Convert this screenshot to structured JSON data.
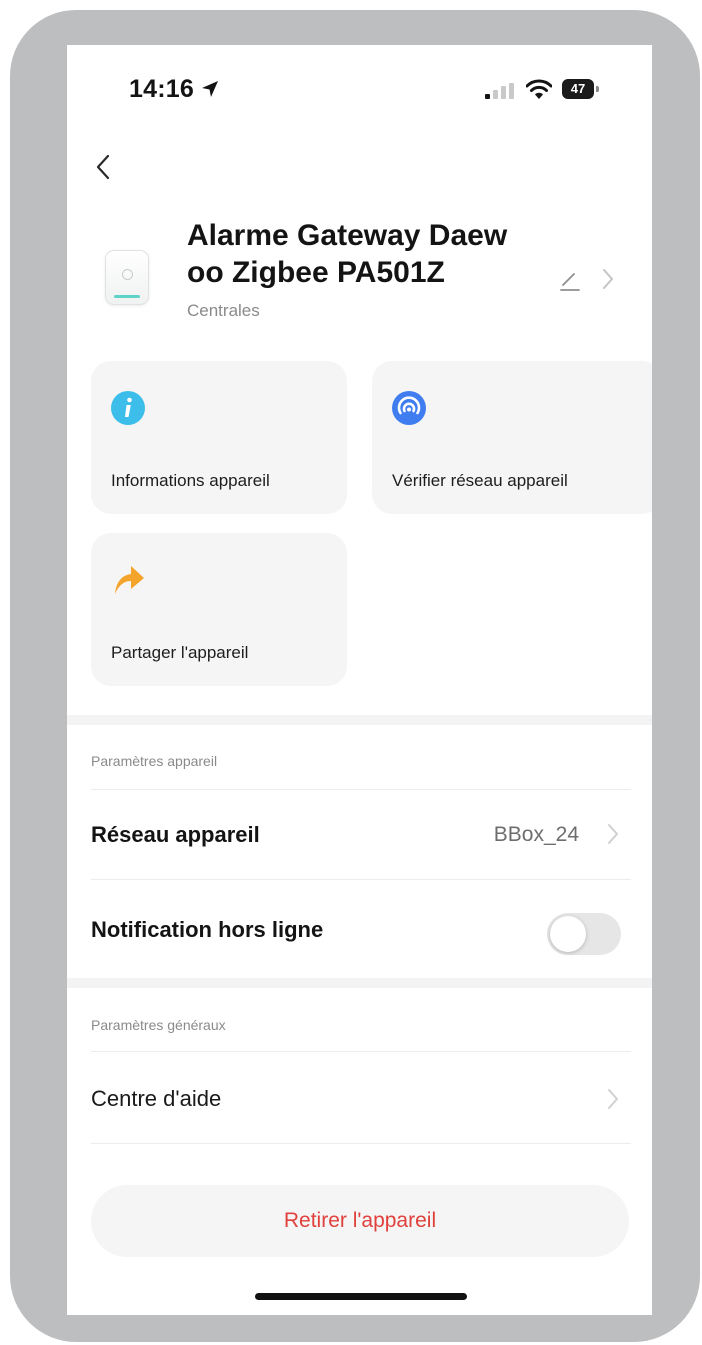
{
  "status_bar": {
    "time": "14:16",
    "battery": "47"
  },
  "device": {
    "name_line1": "Alarme Gateway Daew",
    "name_line2": "oo Zigbee PA501Z",
    "category": "Centrales"
  },
  "actions": [
    {
      "label": "Informations appareil",
      "icon": "info-icon",
      "color": "#3dbde9"
    },
    {
      "label": "Vérifier réseau appareil",
      "icon": "network-icon",
      "color": "#3f7df0"
    },
    {
      "label": "Partager l'appareil",
      "icon": "share-icon",
      "color": "#f4a42a"
    }
  ],
  "device_settings": {
    "title": "Paramètres appareil",
    "network": {
      "label": "Réseau appareil",
      "value": "BBox_24"
    },
    "offline_notification": {
      "label": "Notification hors ligne",
      "enabled": false
    }
  },
  "general_settings": {
    "title": "Paramètres généraux",
    "help": {
      "label": "Centre d'aide"
    }
  },
  "remove_button": "Retirer l'appareil",
  "colors": {
    "danger": "#e0413c",
    "tile_bg": "#f5f5f5",
    "frame": "#bdbebf"
  }
}
